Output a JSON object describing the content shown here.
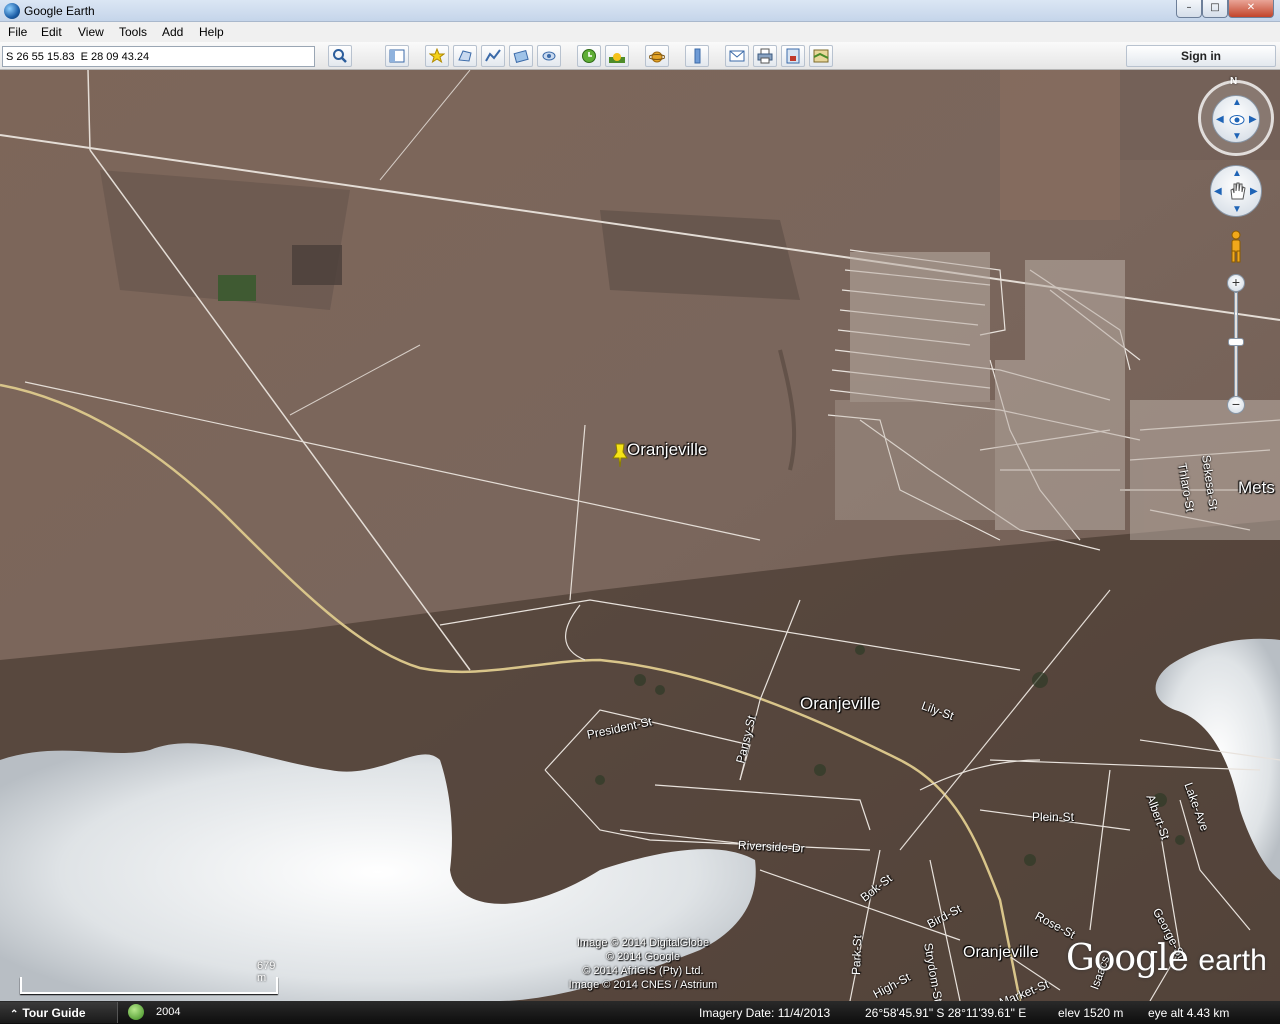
{
  "window": {
    "title": "Google Earth",
    "minimize": "–",
    "maximize": "□",
    "close": "✕"
  },
  "menu": [
    "File",
    "Edit",
    "View",
    "Tools",
    "Add",
    "Help"
  ],
  "toolbar": {
    "search_value": "S 26 55 15.83  E 28 09 43.24",
    "buttons": [
      "search-icon",
      "sidebar-icon",
      "placemark-icon",
      "polygon-icon",
      "path-icon",
      "overlay-icon",
      "tour-icon",
      "historical-imagery-icon",
      "sun-icon",
      "planets-icon",
      "ruler-icon",
      "email-icon",
      "print-icon",
      "save-image-icon",
      "view-in-maps-icon"
    ],
    "sign_in": "Sign in"
  },
  "map": {
    "placemark_label": "Oranjeville",
    "town_labels": [
      "Oranjeville",
      "Oranjeville",
      "Mets"
    ],
    "streets": [
      "President-St",
      "Pansy-St",
      "Lily-St",
      "Riverside-Dr",
      "Plein-St",
      "Albert-St",
      "Lake-Ave",
      "Bok-St",
      "Bird-St",
      "Rose-St",
      "George-St",
      "Park-St",
      "Strydom-St",
      "High-St",
      "Market-St",
      "Sekesa-St",
      "Thlaro-St",
      "Isaacs"
    ],
    "credits": [
      "Image © 2014 DigitalGlobe",
      "© 2014 Google",
      "© 2014 AfriGIS (Pty) Ltd.",
      "Image © 2014 CNES / Astrium"
    ],
    "logo_main": "Google",
    "logo_sub": "earth",
    "scale": "679 m",
    "north": "N"
  },
  "status": {
    "tour_guide": "Tour Guide",
    "history_year": "2004",
    "imagery_date": "Imagery Date: 11/4/2013",
    "coords": "26°58'45.91\" S   28°11'39.61\" E",
    "elev": "elev  1520 m",
    "eye_alt": "eye alt   4.43 km"
  }
}
